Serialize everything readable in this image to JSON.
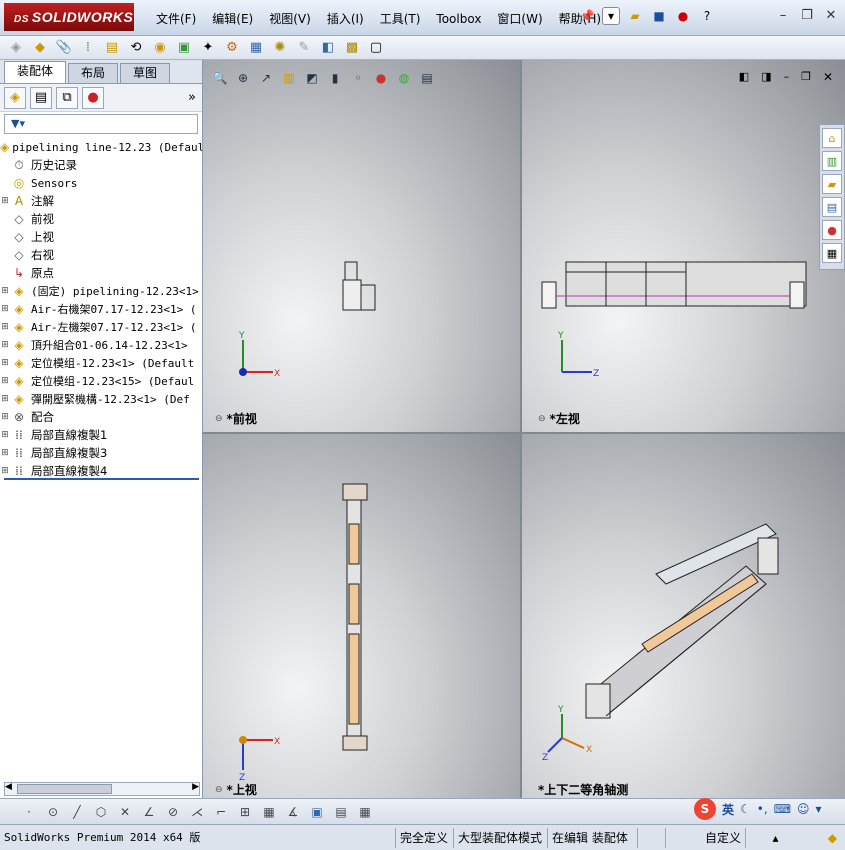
{
  "app": {
    "logo": "SOLIDWORKS"
  },
  "menu": [
    "文件(F)",
    "编辑(E)",
    "视图(V)",
    "插入(I)",
    "工具(T)",
    "Toolbox",
    "窗口(W)",
    "帮助(H)"
  ],
  "panel": {
    "tabs": [
      "装配体",
      "布局",
      "草图"
    ],
    "root": "pipelining line-12.23  (Defaul",
    "items": [
      {
        "label": "历史记录",
        "icon": "history-icon",
        "exp": ""
      },
      {
        "label": "Sensors",
        "icon": "sensor-icon",
        "exp": "",
        "mono": true
      },
      {
        "label": "注解",
        "icon": "annotation-icon",
        "exp": "+"
      },
      {
        "label": "前视",
        "icon": "plane-icon",
        "exp": ""
      },
      {
        "label": "上视",
        "icon": "plane-icon",
        "exp": ""
      },
      {
        "label": "右视",
        "icon": "plane-icon",
        "exp": ""
      },
      {
        "label": "原点",
        "icon": "origin-icon",
        "exp": ""
      },
      {
        "label": "(固定) pipelining-12.23<1>",
        "icon": "assembly-icon",
        "exp": "+",
        "mono": true
      },
      {
        "label": "Air-右機架07.17-12.23<1> (",
        "icon": "assembly-icon",
        "exp": "+",
        "mono": true
      },
      {
        "label": "Air-左機架07.17-12.23<1> (",
        "icon": "assembly-icon",
        "exp": "+",
        "mono": true
      },
      {
        "label": "頂升組合01-06.14-12.23<1>",
        "icon": "assembly-icon",
        "exp": "+",
        "mono": true
      },
      {
        "label": "定位模组-12.23<1> (Default",
        "icon": "assembly-icon",
        "exp": "+",
        "mono": true
      },
      {
        "label": "定位模组-12.23<15> (Defaul",
        "icon": "assembly-icon",
        "exp": "+",
        "mono": true
      },
      {
        "label": "彈開壓緊機構-12.23<1> (Def",
        "icon": "assembly-icon",
        "exp": "+",
        "mono": true
      },
      {
        "label": "配合",
        "icon": "mates-icon",
        "exp": "+"
      },
      {
        "label": "局部直線複製1",
        "icon": "pattern-icon",
        "exp": "+"
      },
      {
        "label": "局部直線複製3",
        "icon": "pattern-icon",
        "exp": "+"
      },
      {
        "label": "局部直線複製4",
        "icon": "pattern-icon",
        "exp": "+"
      }
    ]
  },
  "views": {
    "front": "*前视",
    "left": "*左视",
    "top": "*上视",
    "iso": "*上下二等角轴测"
  },
  "axes": {
    "x": "X",
    "y": "Y",
    "z": "Z"
  },
  "status": {
    "version": "SolidWorks Premium 2014 x64 版",
    "defined": "完全定义",
    "mode": "大型装配体模式",
    "editing": "在编辑 装配体",
    "units": "自定义"
  },
  "ime": {
    "lang": "英"
  }
}
